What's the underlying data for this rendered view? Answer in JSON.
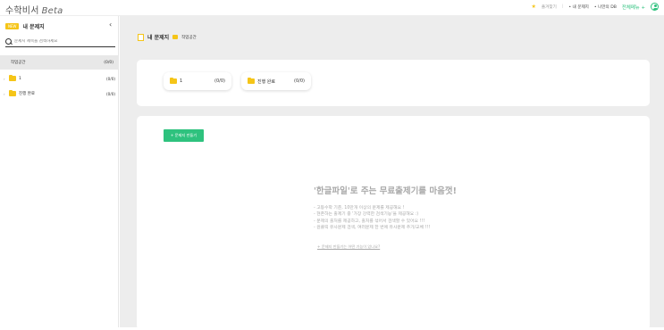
{
  "app": {
    "logo": "수학비서",
    "logo_suffix": "Beta"
  },
  "topnav": {
    "favorites": "즐겨찾기",
    "separator": "|",
    "my_problems": "• 내 문제지",
    "my_db": "• 나만의 DB",
    "all_menu": "전체메뉴 +"
  },
  "sidebar": {
    "badge": "NEW",
    "title": "내 문제지",
    "collapse": "‹",
    "search_placeholder": "문제지 제목을 검색하세요",
    "workspace": {
      "label": "작업공간",
      "count": "(0/0)"
    },
    "items": [
      {
        "label": "1",
        "count": "(0/0)"
      },
      {
        "label": "진행 완료",
        "count": "(0/0)"
      }
    ]
  },
  "main": {
    "breadcrumb_title": "내 문제지",
    "breadcrumb_sub": "작업공간",
    "folders": [
      {
        "label": "1",
        "count": "(0/0)"
      },
      {
        "label": "진행 완료",
        "count": "(0/0)"
      }
    ],
    "create_button": "+ 문제지 만들기",
    "promo_title": "'한글파일'로 주는 무료출제기를 마음껏!",
    "promo_lines": [
      "- 고등수학 기준, 10만개 이상의 문제를 제공해요 !",
      "- 현존하는 출제기 중 '가장 강력한 검색기능'을 제공해요 :)",
      "- 문제의 출처를 제공하고, 출처를 섞어서 검색할 수 있어요 !!!",
      "- 원클릭 유사문제 검색, 여러문제 한 번에 유사문제 추가/교체 !!!"
    ],
    "promo_link": "+ 문제지 만들기는 어떤 기능이 있나요?"
  },
  "colors": {
    "accent_green": "#2ec27e",
    "accent_yellow": "#f5c518",
    "background_gray": "#ededed"
  }
}
